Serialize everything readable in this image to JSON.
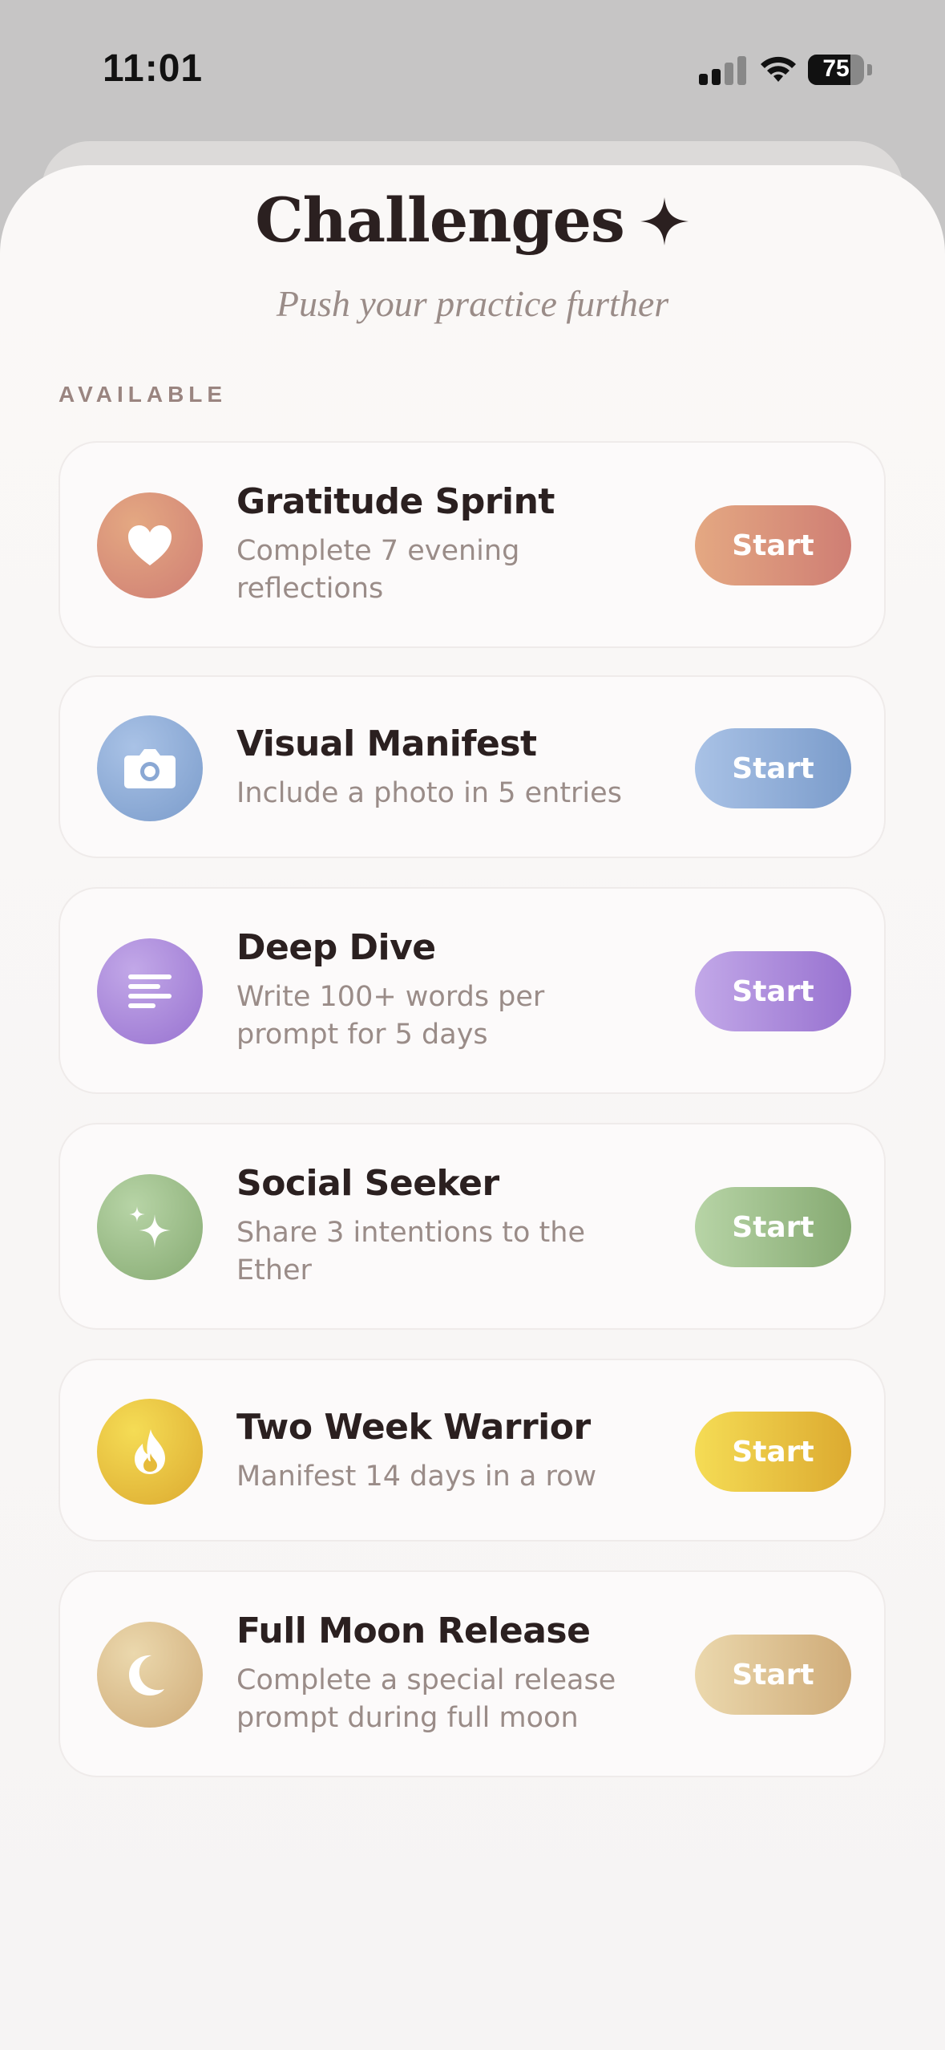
{
  "status_bar": {
    "time": "11:01",
    "battery_percent": "75"
  },
  "header": {
    "title": "Challenges",
    "subtitle": "Push your practice further"
  },
  "section_label": "AVAILABLE",
  "challenges": [
    {
      "name": "Gratitude Sprint",
      "description": "Complete 7 evening reflections",
      "icon": "heart-icon",
      "button": "Start",
      "colors": [
        "#e4a882",
        "#cf7e74"
      ]
    },
    {
      "name": "Visual Manifest",
      "description": "Include a photo in 5 entries",
      "icon": "camera-icon",
      "button": "Start",
      "colors": [
        "#a9c2e6",
        "#7b9ccb"
      ]
    },
    {
      "name": "Deep Dive",
      "description": "Write 100+ words per prompt for 5 days",
      "icon": "text-lines-icon",
      "button": "Start",
      "colors": [
        "#c2a8e8",
        "#9872d0"
      ]
    },
    {
      "name": "Social Seeker",
      "description": "Share 3 intentions to the Ether",
      "icon": "sparkles-icon",
      "button": "Start",
      "colors": [
        "#b7d4a6",
        "#86aa72"
      ]
    },
    {
      "name": "Two Week Warrior",
      "description": "Manifest 14 days in a row",
      "icon": "flame-icon",
      "button": "Start",
      "colors": [
        "#f5dc55",
        "#dcaa30"
      ]
    },
    {
      "name": "Full Moon Release",
      "description": "Complete a special release prompt during full moon",
      "icon": "moon-icon",
      "button": "Start",
      "colors": [
        "#ebd8ad",
        "#cfab78"
      ]
    }
  ]
}
